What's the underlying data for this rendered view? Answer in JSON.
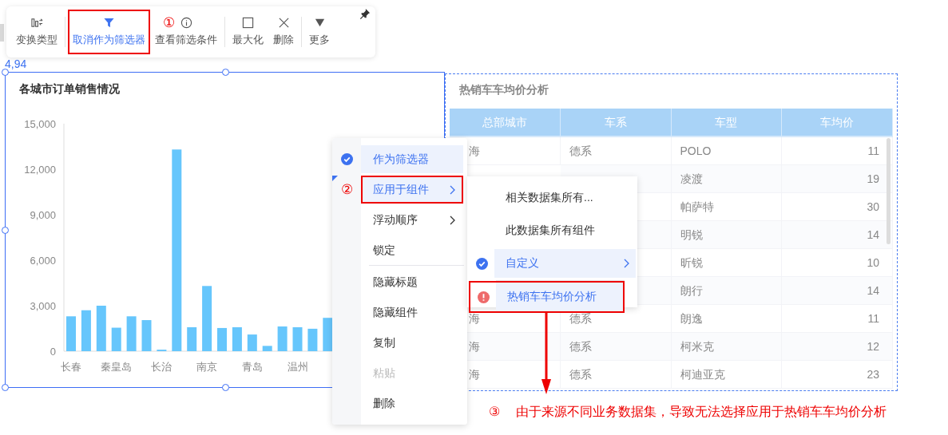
{
  "toolbar": {
    "groups": [
      [
        {
          "kind": "switch",
          "label": "变换类型",
          "selected": false,
          "flagged": false
        }
      ],
      [
        {
          "kind": "filter",
          "label": "取消作为筛选器",
          "selected": true,
          "flagged": true
        },
        {
          "kind": "info",
          "label": "查看筛选条件",
          "selected": false,
          "flagged": false
        }
      ],
      [
        {
          "kind": "maximize",
          "label": "最大化",
          "selected": false,
          "flagged": false
        },
        {
          "kind": "delete",
          "label": "删除",
          "selected": false,
          "flagged": false
        }
      ],
      [
        {
          "kind": "more",
          "label": "更多",
          "selected": false,
          "flagged": false
        }
      ]
    ],
    "marker": "①"
  },
  "position_label": "4,94",
  "chart_panel": {
    "title": "各城市订单销售情况",
    "chart_data": {
      "type": "bar",
      "categories": [
        "长春",
        null,
        null,
        "秦皇岛",
        null,
        null,
        "长治",
        null,
        null,
        "南京",
        null,
        null,
        "青岛",
        null,
        null,
        "温州",
        null,
        null
      ],
      "values": [
        2300,
        2700,
        3000,
        1550,
        2300,
        2050,
        100,
        13300,
        1580,
        4300,
        1530,
        1580,
        1100,
        350,
        1630,
        1580,
        1480,
        2200
      ],
      "ylim": [
        0,
        15000
      ],
      "yticks": [
        {
          "value": 0,
          "label": "0"
        },
        {
          "value": 3000,
          "label": "3,000"
        },
        {
          "value": 6000,
          "label": "6,000"
        },
        {
          "value": 9000,
          "label": "9,000"
        },
        {
          "value": 12000,
          "label": "12,000"
        },
        {
          "value": 15000,
          "label": "15,000"
        }
      ]
    }
  },
  "table_panel": {
    "title": "热销车车均价分析",
    "columns": [
      "总部城市",
      "车系",
      "车型",
      "车均价"
    ],
    "rows": [
      {
        "city": "海",
        "series": "德系",
        "model": "POLO",
        "price": "11"
      },
      {
        "model": "凌渡",
        "price": "19"
      },
      {
        "model": "帕萨特",
        "price": "30"
      },
      {
        "model": "明锐",
        "price": "14"
      },
      {
        "model": "昕锐",
        "price": "10"
      },
      {
        "model": "朗行",
        "price": "14"
      },
      {
        "city": "海",
        "series": "德系",
        "model": "朗逸",
        "price": "11"
      },
      {
        "city": "海",
        "series": "德系",
        "model": "柯米克",
        "price": "12"
      },
      {
        "city": "海",
        "series": "德系",
        "model": "柯迪亚克",
        "price": "23"
      }
    ]
  },
  "context_menu": {
    "groups": [
      [
        {
          "label": "作为筛选器",
          "checked": true,
          "selected": true,
          "has_submenu": false,
          "disabled": false,
          "flagged": false
        },
        {
          "label": "应用于组件",
          "checked": false,
          "selected": true,
          "has_submenu": true,
          "disabled": false,
          "flagged": true,
          "marker": "②"
        },
        {
          "label": "浮动顺序",
          "checked": false,
          "selected": false,
          "has_submenu": true,
          "disabled": false,
          "flagged": false
        },
        {
          "label": "锁定",
          "checked": false,
          "selected": false,
          "has_submenu": false,
          "disabled": false,
          "flagged": false
        }
      ],
      [
        {
          "label": "隐藏标题",
          "checked": false,
          "selected": false,
          "has_submenu": false,
          "disabled": false,
          "flagged": false
        },
        {
          "label": "隐藏组件",
          "checked": false,
          "selected": false,
          "has_submenu": false,
          "disabled": false,
          "flagged": false
        },
        {
          "label": "复制",
          "checked": false,
          "selected": false,
          "has_submenu": false,
          "disabled": false,
          "flagged": false
        },
        {
          "label": "粘贴",
          "checked": false,
          "selected": false,
          "has_submenu": false,
          "disabled": true,
          "flagged": false
        },
        {
          "label": "删除",
          "checked": false,
          "selected": false,
          "has_submenu": false,
          "disabled": false,
          "flagged": false
        }
      ]
    ]
  },
  "submenu": {
    "groups": [
      [
        {
          "label": "相关数据集所有...",
          "checked": false,
          "error": false,
          "selected": false,
          "has_submenu": false,
          "flagged": false
        },
        {
          "label": "此数据集所有组件",
          "checked": false,
          "error": false,
          "selected": false,
          "has_submenu": false,
          "flagged": false
        },
        {
          "label": "自定义",
          "checked": true,
          "error": false,
          "selected": true,
          "has_submenu": true,
          "flagged": false
        }
      ],
      [
        {
          "label": "热销车车均价分析",
          "checked": false,
          "error": true,
          "selected": true,
          "has_submenu": false,
          "flagged": true
        }
      ]
    ]
  },
  "note": {
    "marker": "③",
    "text": "由于来源不同业务数据集，导致无法选择应用于热销车车均价分析"
  }
}
